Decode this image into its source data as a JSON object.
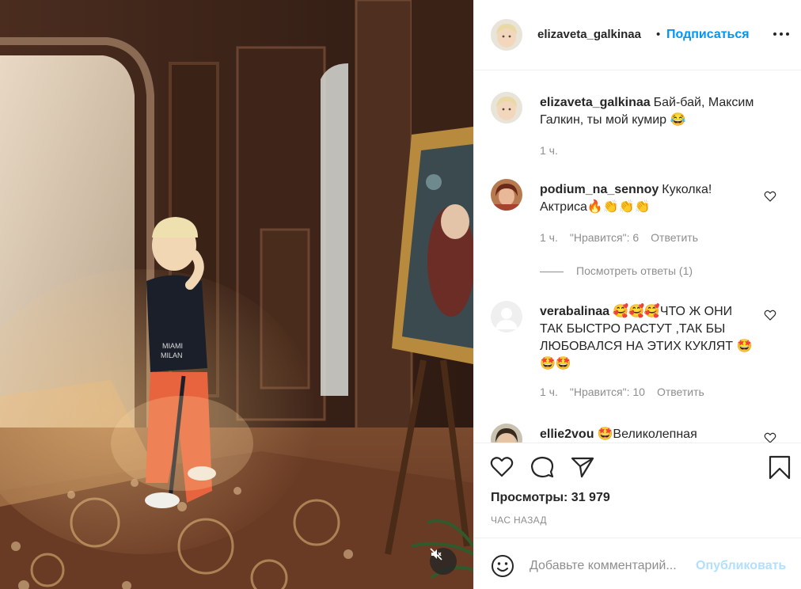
{
  "post": {
    "author": "elizaveta_galkinaa",
    "follow_separator": "•",
    "follow_label": "Подписаться",
    "more_icon": "more-horizontal-icon"
  },
  "caption": {
    "username": "elizaveta_galkinaa",
    "text": "Бай-бай, Максим Галкин, ты мой кумир 😂",
    "time": "1 ч."
  },
  "comments": [
    {
      "username": "podium_na_sennoy",
      "text": "Куколка! Актриса🔥👏👏👏",
      "time": "1 ч.",
      "likes": "\"Нравится\": 6",
      "reply": "Ответить",
      "view_replies": "Посмотреть ответы (1)"
    },
    {
      "username": "verabalinaa",
      "text": "🥰🥰🥰ЧТО Ж ОНИ ТАК БЫСТРО РАСТУТ ,ТАК БЫ ЛЮБОВАЛСЯ НА ЭТИХ КУКЛЯТ 🤩🤩🤩",
      "time": "1 ч.",
      "likes": "\"Нравится\": 10",
      "reply": "Ответить"
    },
    {
      "username": "ellie2vou",
      "text": "🤩Великолепная"
    }
  ],
  "stats": {
    "views_label": "Просмотры:",
    "views_value": "31 979",
    "time_ago": "ЧАС НАЗАД"
  },
  "comment_box": {
    "placeholder": "Добавьте комментарий...",
    "publish": "Опубликовать"
  },
  "colors": {
    "accent": "#0095f6",
    "muted": "#8e8e8e",
    "publish_disabled": "#b2dffc",
    "text": "#262626"
  }
}
